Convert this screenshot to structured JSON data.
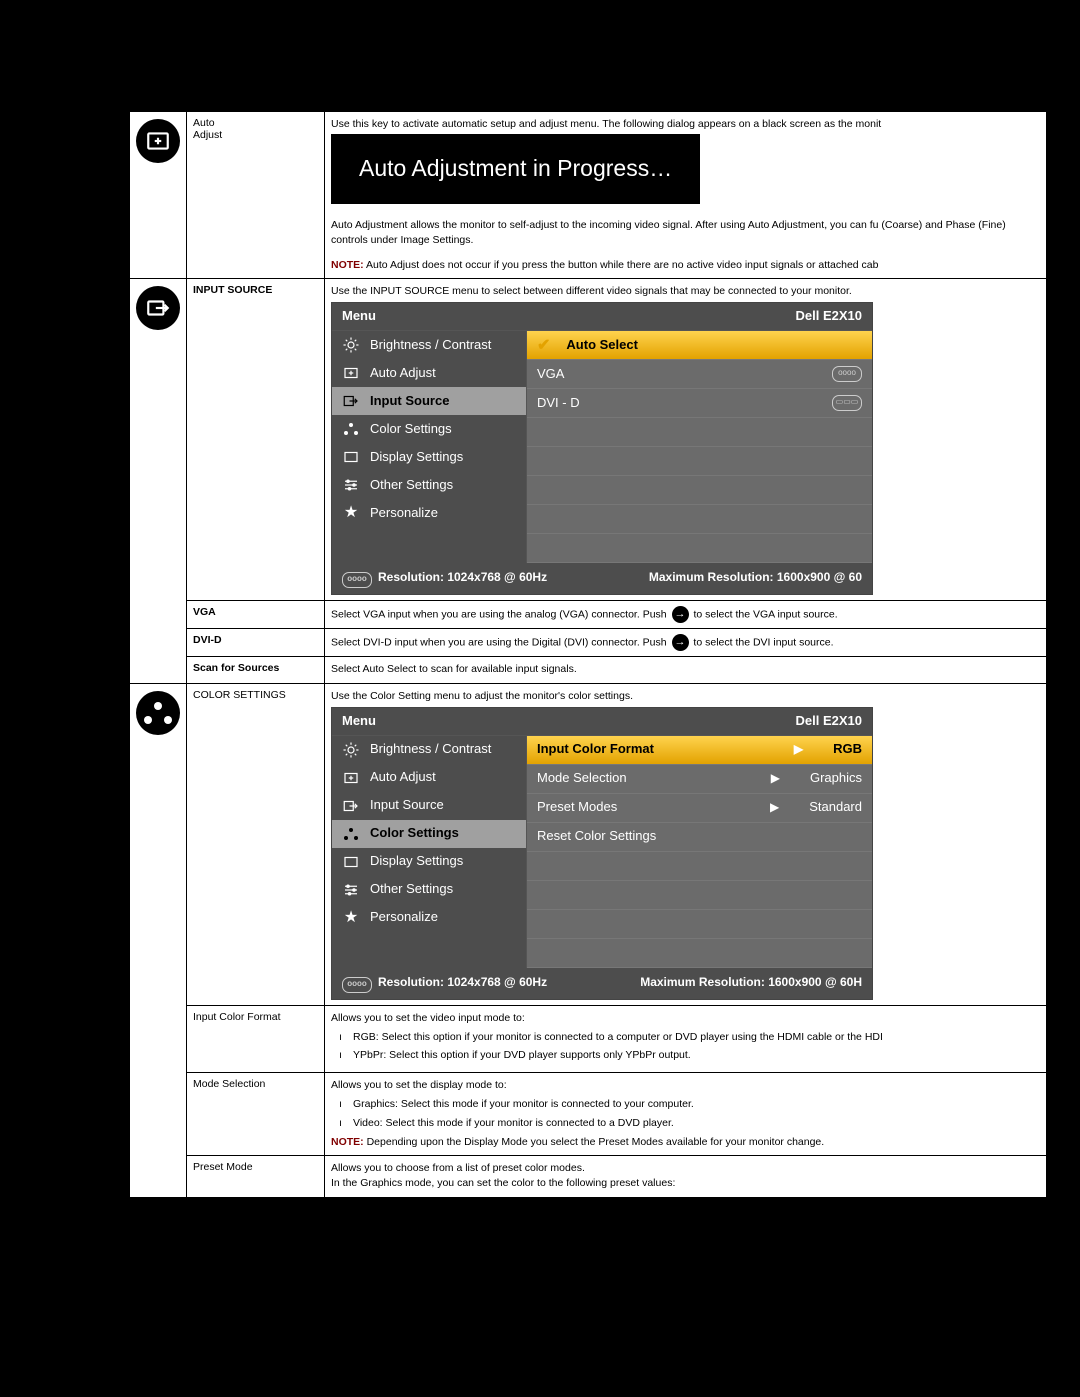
{
  "rows": {
    "autoAdjust": {
      "label1": "Auto",
      "label2": "Adjust",
      "intro": "Use this key to activate automatic setup and adjust menu. The following dialog appears on a black screen as the monit",
      "banner": "Auto Adjustment in Progress…",
      "para2": "Auto Adjustment allows the monitor to self-adjust to the incoming video signal. After using Auto Adjustment, you can fu (Coarse) and Phase (Fine) controls under Image Settings.",
      "notePrefix": "NOTE:",
      "noteText": " Auto Adjust does not occur if you press the button while there are no active video input signals or attached cab"
    },
    "inputSource": {
      "label": "INPUT SOURCE",
      "intro": "Use the INPUT SOURCE menu to select between different video signals that may be connected to your monitor."
    },
    "vga": {
      "label": "VGA",
      "textPre": "Select VGA input when you are using the analog (VGA) connector. Push ",
      "textPost": " to select the VGA input source."
    },
    "dvid": {
      "label": "DVI-D",
      "textPre": "Select DVI-D input when you are using the Digital (DVI) connector. Push ",
      "textPost": " to select the DVI input source."
    },
    "scan": {
      "label": "Scan for Sources",
      "text": "Select Auto Select to scan for available input signals."
    },
    "colorSettings": {
      "label": "COLOR SETTINGS",
      "intro": "Use the Color Setting menu to adjust the monitor's color settings."
    },
    "inputColorFormat": {
      "label": "Input Color Format",
      "intro": "Allows you to set the video input mode to:",
      "b1": "RGB: Select this option if your monitor is connected to a computer or DVD player using the HDMI cable or the HDI",
      "b2": "YPbPr: Select this option if your DVD player supports only YPbPr output."
    },
    "modeSelection": {
      "label": "Mode Selection",
      "intro": "Allows you to set the display mode to:",
      "b1": "Graphics: Select this mode if your monitor is connected to your computer.",
      "b2": "Video: Select this mode if your monitor is connected to a DVD player.",
      "notePrefix": "NOTE:",
      "noteText": " Depending upon the Display Mode you select the Preset Modes available for your monitor change."
    },
    "presetMode": {
      "label": "Preset Mode",
      "line1": "Allows you to choose from a list of preset color modes.",
      "line2": "In the Graphics mode, you can set the color to the following preset values:"
    }
  },
  "osdCommon": {
    "menu": "Menu",
    "brand": "Dell E2X10",
    "left": {
      "brightness": "Brightness / Contrast",
      "autoAdjust": "Auto Adjust",
      "inputSource": "Input Source",
      "colorSettings": "Color Settings",
      "displaySettings": "Display Settings",
      "otherSettings": "Other Settings",
      "personalize": "Personalize"
    },
    "footerRes": "Resolution: 1024x768 @ 60Hz",
    "footerMax1": "Maximum Resolution: 1600x900 @ 60",
    "footerMax2": "Maximum Resolution: 1600x900 @ 60H"
  },
  "osd1_right": {
    "autoSelect": "Auto Select",
    "vga": "VGA",
    "dvid": "DVI - D"
  },
  "osd2_right": {
    "inputColorFormat": "Input Color Format",
    "modeSelection": "Mode Selection",
    "presetModes": "Preset Modes",
    "resetColor": "Reset Color Settings",
    "rgb": "RGB",
    "graphics": "Graphics",
    "standard": "Standard"
  }
}
